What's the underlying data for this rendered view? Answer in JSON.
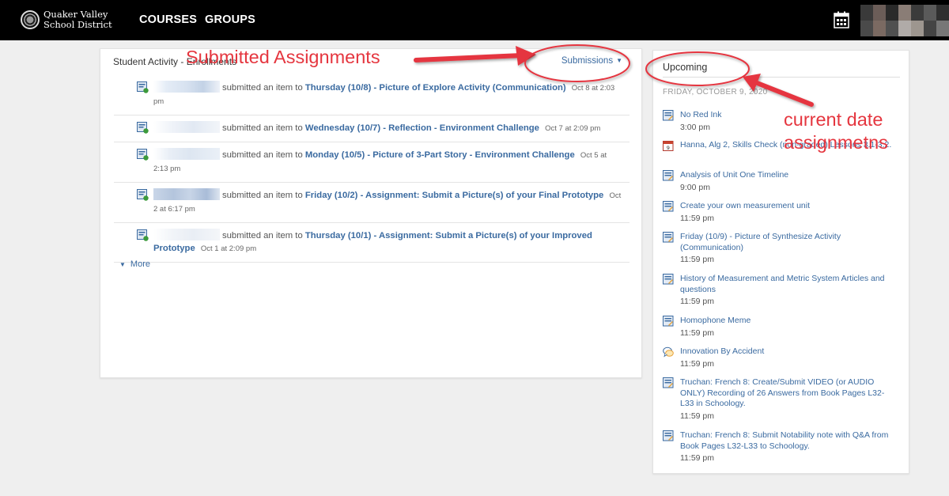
{
  "header": {
    "logo_line1": "Quaker Valley",
    "logo_line2": "School District",
    "nav": [
      "COURSES",
      "GROUPS"
    ],
    "calendar_icon": "calendar-icon",
    "avatar_icon": "user-avatar-blurred"
  },
  "activity": {
    "title": "Student Activity - Enrollments",
    "filter_label": "Submissions",
    "more_label": "More",
    "items": [
      {
        "action": "submitted an item to",
        "assignment": "Thursday (10/8) - Picture of Explore Activity (Communication)",
        "time": "Oct 8 at 2:03 pm"
      },
      {
        "action": "submitted an item to",
        "assignment": "Wednesday (10/7) - Reflection - Environment Challenge",
        "time": "Oct 7 at 2:09 pm"
      },
      {
        "action": "submitted an item to",
        "assignment": "Monday (10/5) - Picture of 3-Part Story - Environment Challenge",
        "time": "Oct 5 at 2:13 pm"
      },
      {
        "action": "submitted an item to",
        "assignment": "Friday (10/2) - Assignment: Submit a Picture(s) of your Final Prototype",
        "time": "Oct 2 at 6:17 pm"
      },
      {
        "action": "submitted an item to",
        "assignment": "Thursday (10/1) - Assignment: Submit a Picture(s) of your Improved Prototype",
        "time": "Oct 1 at 2:09 pm"
      }
    ]
  },
  "upcoming": {
    "title": "Upcoming",
    "date_header": "FRIDAY, OCTOBER 9, 2020",
    "items": [
      {
        "icon": "assignment-icon",
        "title": "No Red Ink",
        "time": "3:00 pm"
      },
      {
        "icon": "calendar-event-icon",
        "title": "Hanna, Alg 2, Skills Check (non-graded) Lessons 3.1-3.2.",
        "time": ""
      },
      {
        "icon": "assignment-icon",
        "title": "Analysis of Unit One Timeline",
        "time": "9:00 pm"
      },
      {
        "icon": "assignment-icon",
        "title": "Create your own measurement unit",
        "time": "11:59 pm"
      },
      {
        "icon": "assignment-icon",
        "title": "Friday (10/9) - Picture of Synthesize Activity (Communication)",
        "time": "11:59 pm"
      },
      {
        "icon": "assignment-icon",
        "title": "History of Measurement and Metric System Articles and questions",
        "time": "11:59 pm"
      },
      {
        "icon": "assignment-icon",
        "title": "Homophone Meme",
        "time": "11:59 pm"
      },
      {
        "icon": "discussion-icon",
        "title": "Innovation By Accident",
        "time": "11:59 pm"
      },
      {
        "icon": "assignment-icon",
        "title": "Truchan: French 8: Create/Submit VIDEO (or AUDIO ONLY) Recording of 26 Answers from Book Pages L32-L33 in Schoology.",
        "time": "11:59 pm"
      },
      {
        "icon": "assignment-icon",
        "title": "Truchan: French 8: Submit Notability note with Q&A from Book Pages L32-L33 to Schoology.",
        "time": "11:59 pm"
      }
    ]
  },
  "annotations": {
    "submitted": "Submitted Assignments",
    "current_line1": "current date",
    "current_line2": "assignmetns",
    "color": "#e5363f"
  }
}
